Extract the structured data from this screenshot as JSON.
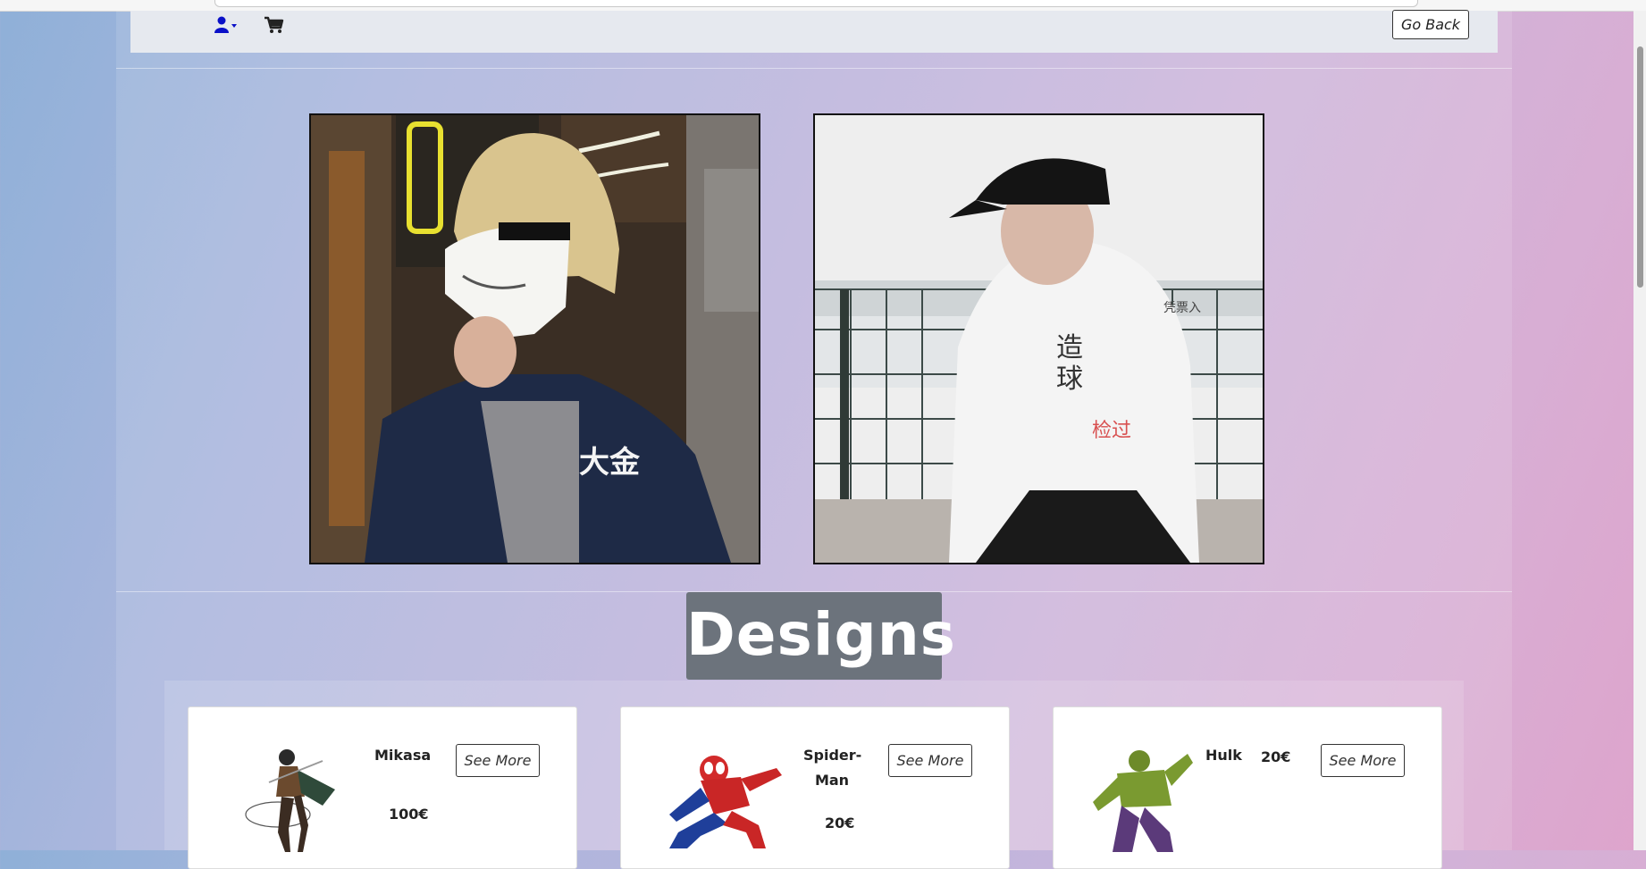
{
  "navbar": {
    "user_icon": "user-dropdown-icon",
    "cart_icon": "shopping-cart-icon",
    "go_back_label": "Go Back"
  },
  "gallery": {
    "images": [
      {
        "alt": "photo-person-mask-jacket"
      },
      {
        "alt": "photo-person-white-hoodie"
      }
    ]
  },
  "designs": {
    "title": "Designs",
    "cards": [
      {
        "name": "Mikasa",
        "price": "100€",
        "button": "See More"
      },
      {
        "name_line1": "Spider-",
        "name_line2": "Man",
        "price": "20€",
        "button": "See More"
      },
      {
        "name": "Hulk",
        "price": "20€",
        "button": "See More"
      }
    ]
  },
  "colors": {
    "accent": "#0000cc",
    "title_bg": "#6c737c",
    "navbar_bg": "#e6e9ef"
  }
}
